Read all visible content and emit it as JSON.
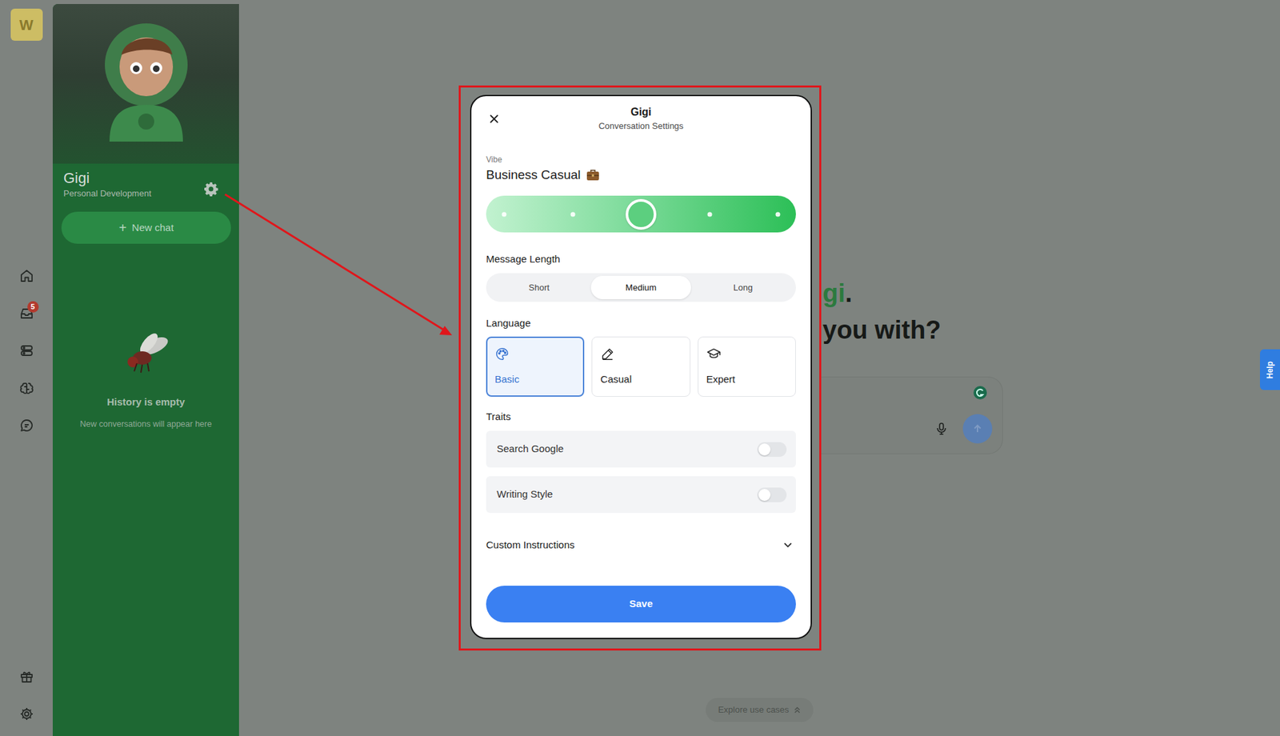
{
  "rail": {
    "logo": "W",
    "inbox_badge": "5"
  },
  "sidebar": {
    "name": "Gigi",
    "subtitle": "Personal Development",
    "new_chat_icon": "+",
    "new_chat": "New chat",
    "history_title": "History is empty",
    "history_subtitle": "New conversations will appear here"
  },
  "background": {
    "heading": {
      "line1_highlight": "gi",
      "line1_rest": ".",
      "line2": "you with?"
    },
    "explore": "Explore use cases",
    "help": "Help"
  },
  "modal": {
    "title": "Gigi",
    "subtitle": "Conversation Settings",
    "vibe": {
      "label": "Vibe",
      "value": "Business Casual",
      "level": 0.5
    },
    "length": {
      "label": "Message Length",
      "options": [
        {
          "label": "Short",
          "selected": false
        },
        {
          "label": "Medium",
          "selected": true
        },
        {
          "label": "Long",
          "selected": false
        }
      ]
    },
    "language": {
      "label": "Language",
      "options": [
        {
          "label": "Basic",
          "selected": true
        },
        {
          "label": "Casual",
          "selected": false
        },
        {
          "label": "Expert",
          "selected": false
        }
      ]
    },
    "traits": {
      "label": "Traits",
      "items": [
        {
          "label": "Search Google",
          "on": false
        },
        {
          "label": "Writing Style",
          "on": false
        }
      ]
    },
    "custom": {
      "label": "Custom Instructions",
      "expanded": false
    },
    "save": "Save"
  }
}
